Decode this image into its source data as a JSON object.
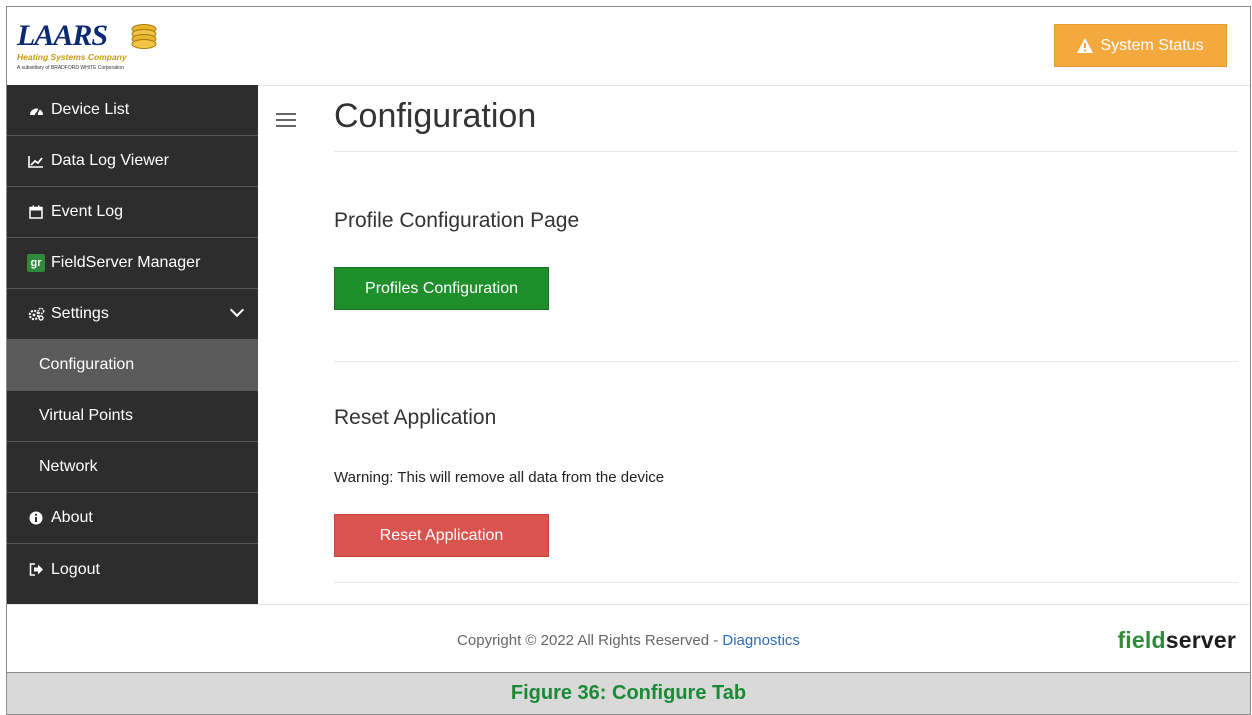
{
  "header": {
    "logo": {
      "brand": "LAARS",
      "tagline": "Heating Systems Company",
      "subline": "A subsidiary of BRADFORD WHITE Corporation"
    },
    "system_status_label": "System Status"
  },
  "sidebar": {
    "items": [
      {
        "label": "Device List",
        "icon": "dashboard-icon"
      },
      {
        "label": "Data Log Viewer",
        "icon": "line-chart-icon"
      },
      {
        "label": "Event Log",
        "icon": "calendar-icon"
      },
      {
        "label": "FieldServer Manager",
        "icon": "gr-icon",
        "icon_text": "gr"
      },
      {
        "label": "Settings",
        "icon": "gears-icon",
        "expanded": true
      },
      {
        "label": "Configuration",
        "active": true
      },
      {
        "label": "Virtual Points"
      },
      {
        "label": "Network"
      },
      {
        "label": "About",
        "icon": "info-icon"
      },
      {
        "label": "Logout",
        "icon": "logout-icon"
      }
    ]
  },
  "main": {
    "title": "Configuration",
    "profile_section": {
      "title": "Profile Configuration Page",
      "button_label": "Profiles Configuration"
    },
    "reset_section": {
      "title": "Reset Application",
      "warning": "Warning: This will remove all data from the device",
      "button_label": "Reset Application"
    }
  },
  "footer": {
    "copyright": "Copyright © 2022 All Rights Reserved - ",
    "diagnostics_link": "Diagnostics",
    "logo_part1": "field",
    "logo_part2": "server"
  },
  "caption": "Figure 36: Configure Tab",
  "colors": {
    "sidebar_bg": "#2d2d2d",
    "active_item_bg": "#5b5b5b",
    "status_orange": "#f4a93f",
    "primary_green": "#1f8f2c",
    "danger_red": "#d9534f",
    "caption_green": "#1b8a36",
    "link_blue": "#2a6ebb"
  }
}
